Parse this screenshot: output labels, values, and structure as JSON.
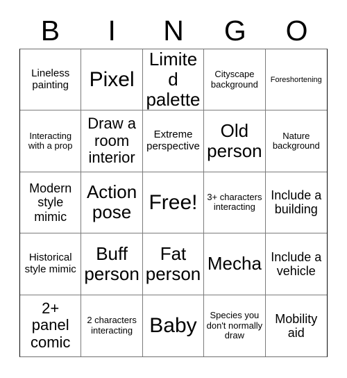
{
  "card": {
    "title": "BINGO",
    "header_letters": [
      "B",
      "I",
      "N",
      "G",
      "O"
    ],
    "free_space_label": "Free!",
    "grid_size": "5x5",
    "colors": {
      "text": "#000000",
      "background": "#ffffff",
      "grid_line": "#7b7b7b",
      "grid_border": "#0a0a0a"
    },
    "rows": [
      [
        {
          "text": "Lineless painting",
          "size": "sm"
        },
        {
          "text": "Pixel",
          "size": "xxl"
        },
        {
          "text": "Limited palette",
          "size": "xl"
        },
        {
          "text": "Cityscape background",
          "size": "xs"
        },
        {
          "text": "Foreshortening",
          "size": "xxs"
        }
      ],
      [
        {
          "text": "Interacting with a prop",
          "size": "xs"
        },
        {
          "text": "Draw a room interior",
          "size": "lg"
        },
        {
          "text": "Extreme perspective",
          "size": "sm"
        },
        {
          "text": "Old person",
          "size": "xl"
        },
        {
          "text": "Nature background",
          "size": "xs"
        }
      ],
      [
        {
          "text": "Modern style mimic",
          "size": "md"
        },
        {
          "text": "Action pose",
          "size": "xl"
        },
        {
          "text": "Free!",
          "size": "xxl"
        },
        {
          "text": "3+ characters interacting",
          "size": "xs"
        },
        {
          "text": "Include a building",
          "size": "md"
        }
      ],
      [
        {
          "text": "Historical style mimic",
          "size": "sm"
        },
        {
          "text": "Buff person",
          "size": "xl"
        },
        {
          "text": "Fat person",
          "size": "xl"
        },
        {
          "text": "Mecha",
          "size": "xl"
        },
        {
          "text": "Include a vehicle",
          "size": "md"
        }
      ],
      [
        {
          "text": "2+ panel comic",
          "size": "lg"
        },
        {
          "text": "2 characters interacting",
          "size": "xs"
        },
        {
          "text": "Baby",
          "size": "xxl"
        },
        {
          "text": "Species you don't normally draw",
          "size": "xs"
        },
        {
          "text": "Mobility aid",
          "size": "md"
        }
      ]
    ]
  }
}
